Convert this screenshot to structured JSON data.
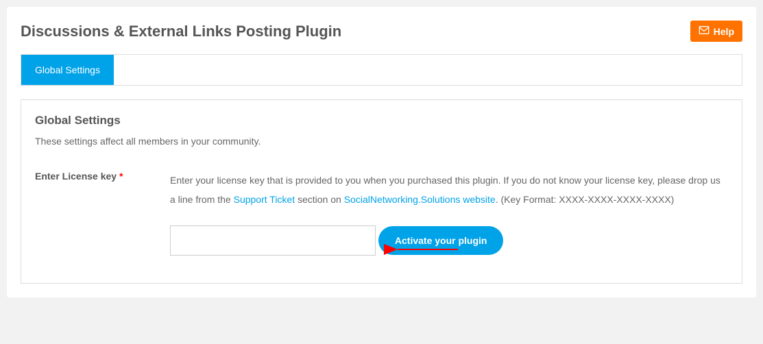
{
  "header": {
    "title": "Discussions & External Links Posting Plugin",
    "help_label": "Help"
  },
  "tabs": {
    "global_settings": "Global Settings"
  },
  "section": {
    "title": "Global Settings",
    "description": "These settings affect all members in your community."
  },
  "license": {
    "label": "Enter License key",
    "required_symbol": "*",
    "desc_part1": "Enter your license key that is provided to you when you purchased this plugin. If you do not know your license key, please drop us a line from the ",
    "support_ticket_link": "Support Ticket",
    "desc_part2": " section on ",
    "sns_link": "SocialNetworking.Solutions website",
    "desc_part3": ". (Key Format: XXXX-XXXX-XXXX-XXXX)",
    "input_value": ""
  },
  "buttons": {
    "activate": "Activate your plugin"
  }
}
